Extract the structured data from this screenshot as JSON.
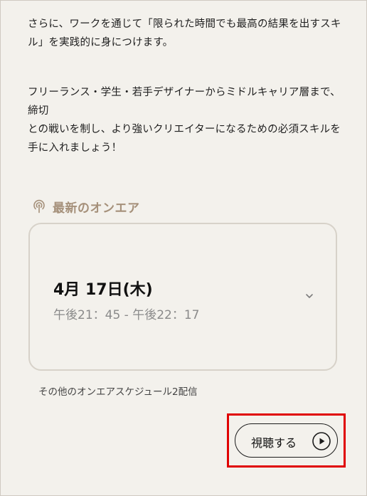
{
  "description": {
    "paragraph1_line1": "さらに、ワークを通じて「限られた時間でも最高の結果を出すスキ",
    "paragraph1_line2": "ル」を実践的に身につけます。",
    "paragraph2_line1": "フリーランス・学生・若手デザイナーからミドルキャリア層まで、締切",
    "paragraph2_line2": "との戦いを制し、より強いクリエイターになるための必須スキルを",
    "paragraph2_line3": "手に入れましょう！"
  },
  "onair": {
    "section_title": "最新のオンエア",
    "date": "4月 17日(木)",
    "time": "午後21：45 - 午後22：17",
    "other_schedules_label": "その他のオンエアスケジュール2配信"
  },
  "watch": {
    "label": "視聴する"
  },
  "colors": {
    "background": "#f3f1ec",
    "accent_tan": "#a5907a",
    "highlight": "#e00000"
  }
}
